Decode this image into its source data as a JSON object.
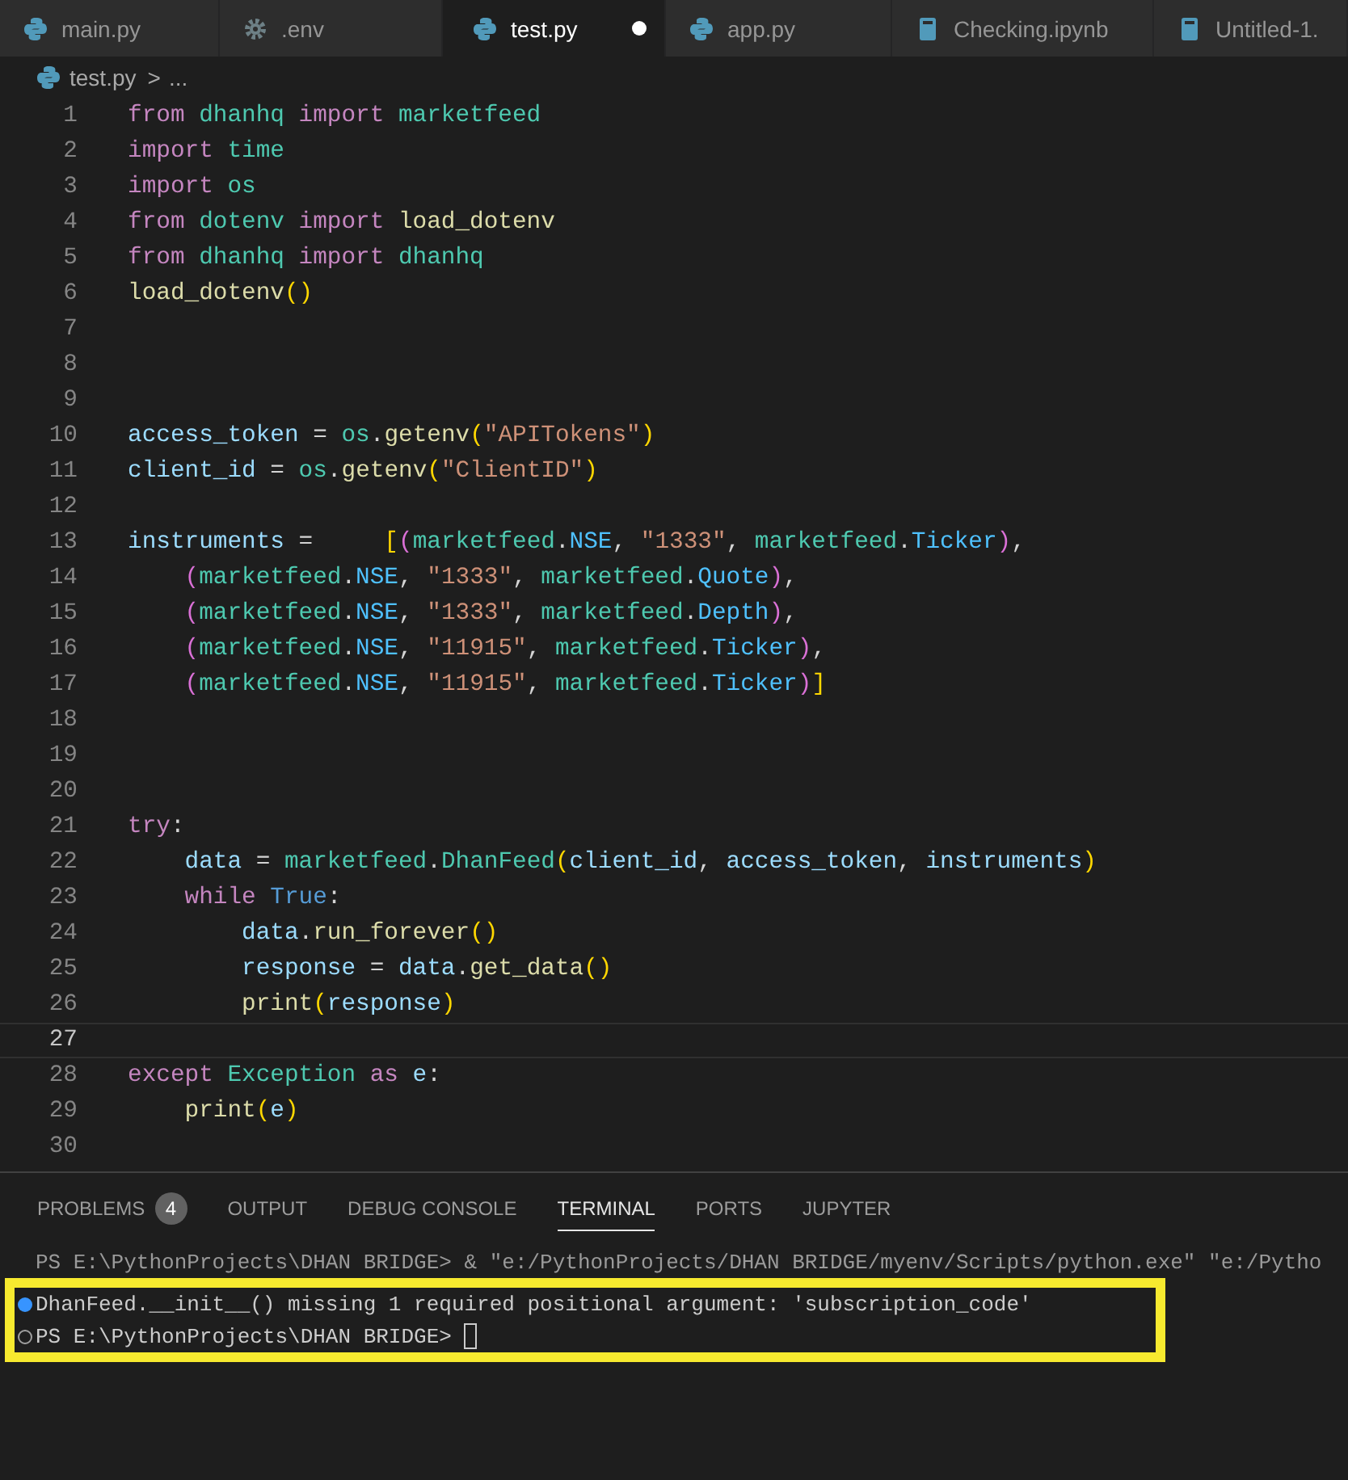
{
  "tabs": [
    {
      "label": "main.py",
      "kind": "python",
      "selected": false,
      "modified": false
    },
    {
      "label": ".env",
      "kind": "settings",
      "selected": false,
      "modified": false
    },
    {
      "label": "test.py",
      "kind": "python",
      "selected": true,
      "modified": true
    },
    {
      "label": "app.py",
      "kind": "python",
      "selected": false,
      "modified": false
    },
    {
      "label": "Checking.ipynb",
      "kind": "notebook",
      "selected": false,
      "modified": false
    },
    {
      "label": "Untitled-1.",
      "kind": "notebook",
      "selected": false,
      "modified": false
    }
  ],
  "breadcrumb": {
    "file": "test.py",
    "separator": ">",
    "rest": "..."
  },
  "editor": {
    "lines": [
      {
        "n": "1",
        "current": false,
        "tokens": [
          {
            "text": "from",
            "kind": "kw"
          },
          {
            "text": " dhanhq",
            "kind": "mod"
          },
          {
            "text": " import",
            "kind": "kw"
          },
          {
            "text": " marketfeed",
            "kind": "mod"
          }
        ]
      },
      {
        "n": "2",
        "current": false,
        "tokens": [
          {
            "text": "import",
            "kind": "kw"
          },
          {
            "text": " time",
            "kind": "mod"
          }
        ]
      },
      {
        "n": "3",
        "current": false,
        "tokens": [
          {
            "text": "import",
            "kind": "kw"
          },
          {
            "text": " os",
            "kind": "mod"
          }
        ]
      },
      {
        "n": "4",
        "current": false,
        "tokens": [
          {
            "text": "from",
            "kind": "kw"
          },
          {
            "text": " dotenv",
            "kind": "mod"
          },
          {
            "text": " import",
            "kind": "kw"
          },
          {
            "text": " load_dotenv",
            "kind": "fn"
          }
        ]
      },
      {
        "n": "5",
        "current": false,
        "tokens": [
          {
            "text": "from",
            "kind": "kw"
          },
          {
            "text": " dhanhq",
            "kind": "mod"
          },
          {
            "text": " import",
            "kind": "kw"
          },
          {
            "text": " dhanhq",
            "kind": "mod"
          }
        ]
      },
      {
        "n": "6",
        "current": false,
        "tokens": [
          {
            "text": "load_dotenv",
            "kind": "fn"
          },
          {
            "text": "()",
            "kind": "b1"
          }
        ]
      },
      {
        "n": "7",
        "current": false
      },
      {
        "n": "8",
        "current": false
      },
      {
        "n": "9",
        "current": false
      },
      {
        "n": "10",
        "current": false,
        "tokens": [
          {
            "text": "access_token",
            "kind": "var"
          },
          {
            "text": " =",
            "kind": "op"
          },
          {
            "text": " os",
            "kind": "mod"
          },
          {
            "text": ".",
            "kind": "op"
          },
          {
            "text": "getenv",
            "kind": "fn"
          },
          {
            "text": "(",
            "kind": "b1"
          },
          {
            "text": "\"APITokens\"",
            "kind": "str"
          },
          {
            "text": ")",
            "kind": "b1"
          }
        ]
      },
      {
        "n": "11",
        "current": false,
        "tokens": [
          {
            "text": "client_id",
            "kind": "var"
          },
          {
            "text": " =",
            "kind": "op"
          },
          {
            "text": " os",
            "kind": "mod"
          },
          {
            "text": ".",
            "kind": "op"
          },
          {
            "text": "getenv",
            "kind": "fn"
          },
          {
            "text": "(",
            "kind": "b1"
          },
          {
            "text": "\"ClientID\"",
            "kind": "str"
          },
          {
            "text": ")",
            "kind": "b1"
          }
        ]
      },
      {
        "n": "12",
        "current": false
      },
      {
        "n": "13",
        "current": false,
        "tokens": [
          {
            "text": "instruments",
            "kind": "var"
          },
          {
            "text": " =",
            "kind": "op"
          },
          {
            "text": "     [",
            "kind": "b1"
          },
          {
            "text": "(",
            "kind": "b2"
          },
          {
            "text": "marketfeed",
            "kind": "mod"
          },
          {
            "text": ".",
            "kind": "op"
          },
          {
            "text": "NSE",
            "kind": "const"
          },
          {
            "text": ",",
            "kind": "op"
          },
          {
            "text": " \"1333\"",
            "kind": "str"
          },
          {
            "text": ",",
            "kind": "op"
          },
          {
            "text": " marketfeed",
            "kind": "mod"
          },
          {
            "text": ".",
            "kind": "op"
          },
          {
            "text": "Ticker",
            "kind": "const"
          },
          {
            "text": ")",
            "kind": "b2"
          },
          {
            "text": ",",
            "kind": "op"
          }
        ]
      },
      {
        "n": "14",
        "current": false,
        "tokens": [
          {
            "text": "    (",
            "kind": "b2"
          },
          {
            "text": "marketfeed",
            "kind": "mod"
          },
          {
            "text": ".",
            "kind": "op"
          },
          {
            "text": "NSE",
            "kind": "const"
          },
          {
            "text": ",",
            "kind": "op"
          },
          {
            "text": " \"1333\"",
            "kind": "str"
          },
          {
            "text": ",",
            "kind": "op"
          },
          {
            "text": " marketfeed",
            "kind": "mod"
          },
          {
            "text": ".",
            "kind": "op"
          },
          {
            "text": "Quote",
            "kind": "const"
          },
          {
            "text": ")",
            "kind": "b2"
          },
          {
            "text": ",",
            "kind": "op"
          }
        ]
      },
      {
        "n": "15",
        "current": false,
        "tokens": [
          {
            "text": "    (",
            "kind": "b2"
          },
          {
            "text": "marketfeed",
            "kind": "mod"
          },
          {
            "text": ".",
            "kind": "op"
          },
          {
            "text": "NSE",
            "kind": "const"
          },
          {
            "text": ",",
            "kind": "op"
          },
          {
            "text": " \"1333\"",
            "kind": "str"
          },
          {
            "text": ",",
            "kind": "op"
          },
          {
            "text": " marketfeed",
            "kind": "mod"
          },
          {
            "text": ".",
            "kind": "op"
          },
          {
            "text": "Depth",
            "kind": "const"
          },
          {
            "text": ")",
            "kind": "b2"
          },
          {
            "text": ",",
            "kind": "op"
          }
        ]
      },
      {
        "n": "16",
        "current": false,
        "tokens": [
          {
            "text": "    (",
            "kind": "b2"
          },
          {
            "text": "marketfeed",
            "kind": "mod"
          },
          {
            "text": ".",
            "kind": "op"
          },
          {
            "text": "NSE",
            "kind": "const"
          },
          {
            "text": ",",
            "kind": "op"
          },
          {
            "text": " \"11915\"",
            "kind": "str"
          },
          {
            "text": ",",
            "kind": "op"
          },
          {
            "text": " marketfeed",
            "kind": "mod"
          },
          {
            "text": ".",
            "kind": "op"
          },
          {
            "text": "Ticker",
            "kind": "const"
          },
          {
            "text": ")",
            "kind": "b2"
          },
          {
            "text": ",",
            "kind": "op"
          }
        ]
      },
      {
        "n": "17",
        "current": false,
        "tokens": [
          {
            "text": "    (",
            "kind": "b2"
          },
          {
            "text": "marketfeed",
            "kind": "mod"
          },
          {
            "text": ".",
            "kind": "op"
          },
          {
            "text": "NSE",
            "kind": "const"
          },
          {
            "text": ",",
            "kind": "op"
          },
          {
            "text": " \"11915\"",
            "kind": "str"
          },
          {
            "text": ",",
            "kind": "op"
          },
          {
            "text": " marketfeed",
            "kind": "mod"
          },
          {
            "text": ".",
            "kind": "op"
          },
          {
            "text": "Ticker",
            "kind": "const"
          },
          {
            "text": ")",
            "kind": "b2"
          },
          {
            "text": "]",
            "kind": "b1"
          }
        ]
      },
      {
        "n": "18",
        "current": false
      },
      {
        "n": "19",
        "current": false
      },
      {
        "n": "20",
        "current": false
      },
      {
        "n": "21",
        "current": false,
        "tokens": [
          {
            "text": "try",
            "kind": "kw"
          },
          {
            "text": ":",
            "kind": "op"
          }
        ]
      },
      {
        "n": "22",
        "current": false,
        "tokens": [
          {
            "text": "    data",
            "kind": "var"
          },
          {
            "text": " =",
            "kind": "op"
          },
          {
            "text": " marketfeed",
            "kind": "mod"
          },
          {
            "text": ".",
            "kind": "op"
          },
          {
            "text": "DhanFeed",
            "kind": "mod"
          },
          {
            "text": "(",
            "kind": "b1"
          },
          {
            "text": "client_id",
            "kind": "var"
          },
          {
            "text": ",",
            "kind": "op"
          },
          {
            "text": " access_token",
            "kind": "var"
          },
          {
            "text": ",",
            "kind": "op"
          },
          {
            "text": " instruments",
            "kind": "var"
          },
          {
            "text": ")",
            "kind": "b1"
          }
        ]
      },
      {
        "n": "23",
        "current": false,
        "tokens": [
          {
            "text": "    while",
            "kind": "kw"
          },
          {
            "text": " True",
            "kind": "bool"
          },
          {
            "text": ":",
            "kind": "op"
          }
        ]
      },
      {
        "n": "24",
        "current": false,
        "tokens": [
          {
            "text": "        data",
            "kind": "var"
          },
          {
            "text": ".",
            "kind": "op"
          },
          {
            "text": "run_forever",
            "kind": "fn"
          },
          {
            "text": "()",
            "kind": "b1"
          }
        ]
      },
      {
        "n": "25",
        "current": false,
        "tokens": [
          {
            "text": "        response",
            "kind": "var"
          },
          {
            "text": " =",
            "kind": "op"
          },
          {
            "text": " data",
            "kind": "var"
          },
          {
            "text": ".",
            "kind": "op"
          },
          {
            "text": "get_data",
            "kind": "fn"
          },
          {
            "text": "()",
            "kind": "b1"
          }
        ]
      },
      {
        "n": "26",
        "current": false,
        "tokens": [
          {
            "text": "        print",
            "kind": "fn"
          },
          {
            "text": "(",
            "kind": "b1"
          },
          {
            "text": "response",
            "kind": "var"
          },
          {
            "text": ")",
            "kind": "b1"
          }
        ]
      },
      {
        "n": "27",
        "current": true
      },
      {
        "n": "28",
        "current": false,
        "tokens": [
          {
            "text": "except",
            "kind": "kw"
          },
          {
            "text": " Exception",
            "kind": "mod"
          },
          {
            "text": " as",
            "kind": "kw"
          },
          {
            "text": " e",
            "kind": "var"
          },
          {
            "text": ":",
            "kind": "op"
          }
        ]
      },
      {
        "n": "29",
        "current": false,
        "tokens": [
          {
            "text": "    print",
            "kind": "fn"
          },
          {
            "text": "(",
            "kind": "b1"
          },
          {
            "text": "e",
            "kind": "var"
          },
          {
            "text": ")",
            "kind": "b1"
          }
        ]
      },
      {
        "n": "30",
        "current": false
      }
    ]
  },
  "panel_tabs": [
    {
      "label": "PROBLEMS",
      "badge": "4",
      "selected": false
    },
    {
      "label": "OUTPUT",
      "selected": false
    },
    {
      "label": "DEBUG CONSOLE",
      "selected": false
    },
    {
      "label": "TERMINAL",
      "selected": true
    },
    {
      "label": "PORTS",
      "selected": false
    },
    {
      "label": "JUPYTER",
      "selected": false
    }
  ],
  "terminal": [
    {
      "kind": "plain",
      "text": "PS E:\\PythonProjects\\DHAN BRIDGE> & \"e:/PythonProjects/DHAN BRIDGE/myenv/Scripts/python.exe\" \"e:/Pytho"
    },
    {
      "kind": "success",
      "text": "DhanFeed.__init__() missing 1 required positional argument: 'subscription_code'"
    },
    {
      "kind": "pending",
      "text": "PS E:\\PythonProjects\\DHAN BRIDGE>",
      "cursor": true
    }
  ]
}
